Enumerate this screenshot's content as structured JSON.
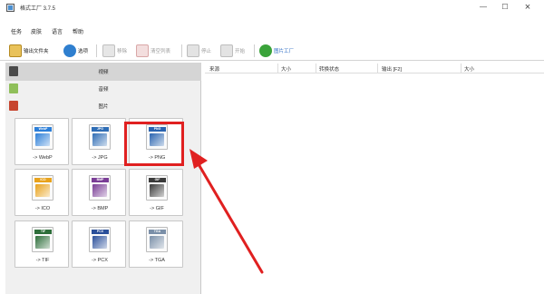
{
  "window": {
    "title": "格式工厂 3.7.5",
    "min_glyph": "—",
    "max_glyph": "☐",
    "close_glyph": "×"
  },
  "menu": [
    {
      "label": "任务"
    },
    {
      "label": "皮肤"
    },
    {
      "label": "语言"
    },
    {
      "label": "帮助"
    }
  ],
  "toolbar": {
    "output_folder": "输出文件夹",
    "options": "选项",
    "remove": "移除",
    "clear_list": "清空列表",
    "stop": "停止",
    "start": "开始",
    "format_factory": "图片工厂"
  },
  "sidebar": {
    "categories": [
      {
        "label": "视频",
        "icon": "video-icon"
      },
      {
        "label": "音频",
        "icon": "audio-icon"
      },
      {
        "label": "图片",
        "icon": "image-icon"
      }
    ],
    "selected_index": 0
  },
  "formats": [
    {
      "label": "-> WebP",
      "tag": "WebP",
      "color": "#2d7fd8"
    },
    {
      "label": "-> JPG",
      "tag": "JPG",
      "color": "#2f6db5"
    },
    {
      "label": "-> PNG",
      "tag": "PNG",
      "color": "#2a64b0"
    },
    {
      "label": "-> ICO",
      "tag": "ICO",
      "color": "#e8a21c"
    },
    {
      "label": "-> BMP",
      "tag": "BMP",
      "color": "#7a3d96"
    },
    {
      "label": "-> GIF",
      "tag": "GIF",
      "color": "#3a3a3a"
    },
    {
      "label": "-> TIF",
      "tag": "TIF",
      "color": "#2d6e3a"
    },
    {
      "label": "-> PCX",
      "tag": "PCX",
      "color": "#2a4f9a"
    },
    {
      "label": "-> TGA",
      "tag": "TGA",
      "color": "#7a8fa8"
    }
  ],
  "list": {
    "columns": [
      "来源",
      "大小",
      "转换状态",
      "输出 [F2]",
      "大小"
    ]
  },
  "colors": {
    "highlight": "#e02020",
    "arrow": "#e02020",
    "selected_row": "#d5d5d5"
  }
}
